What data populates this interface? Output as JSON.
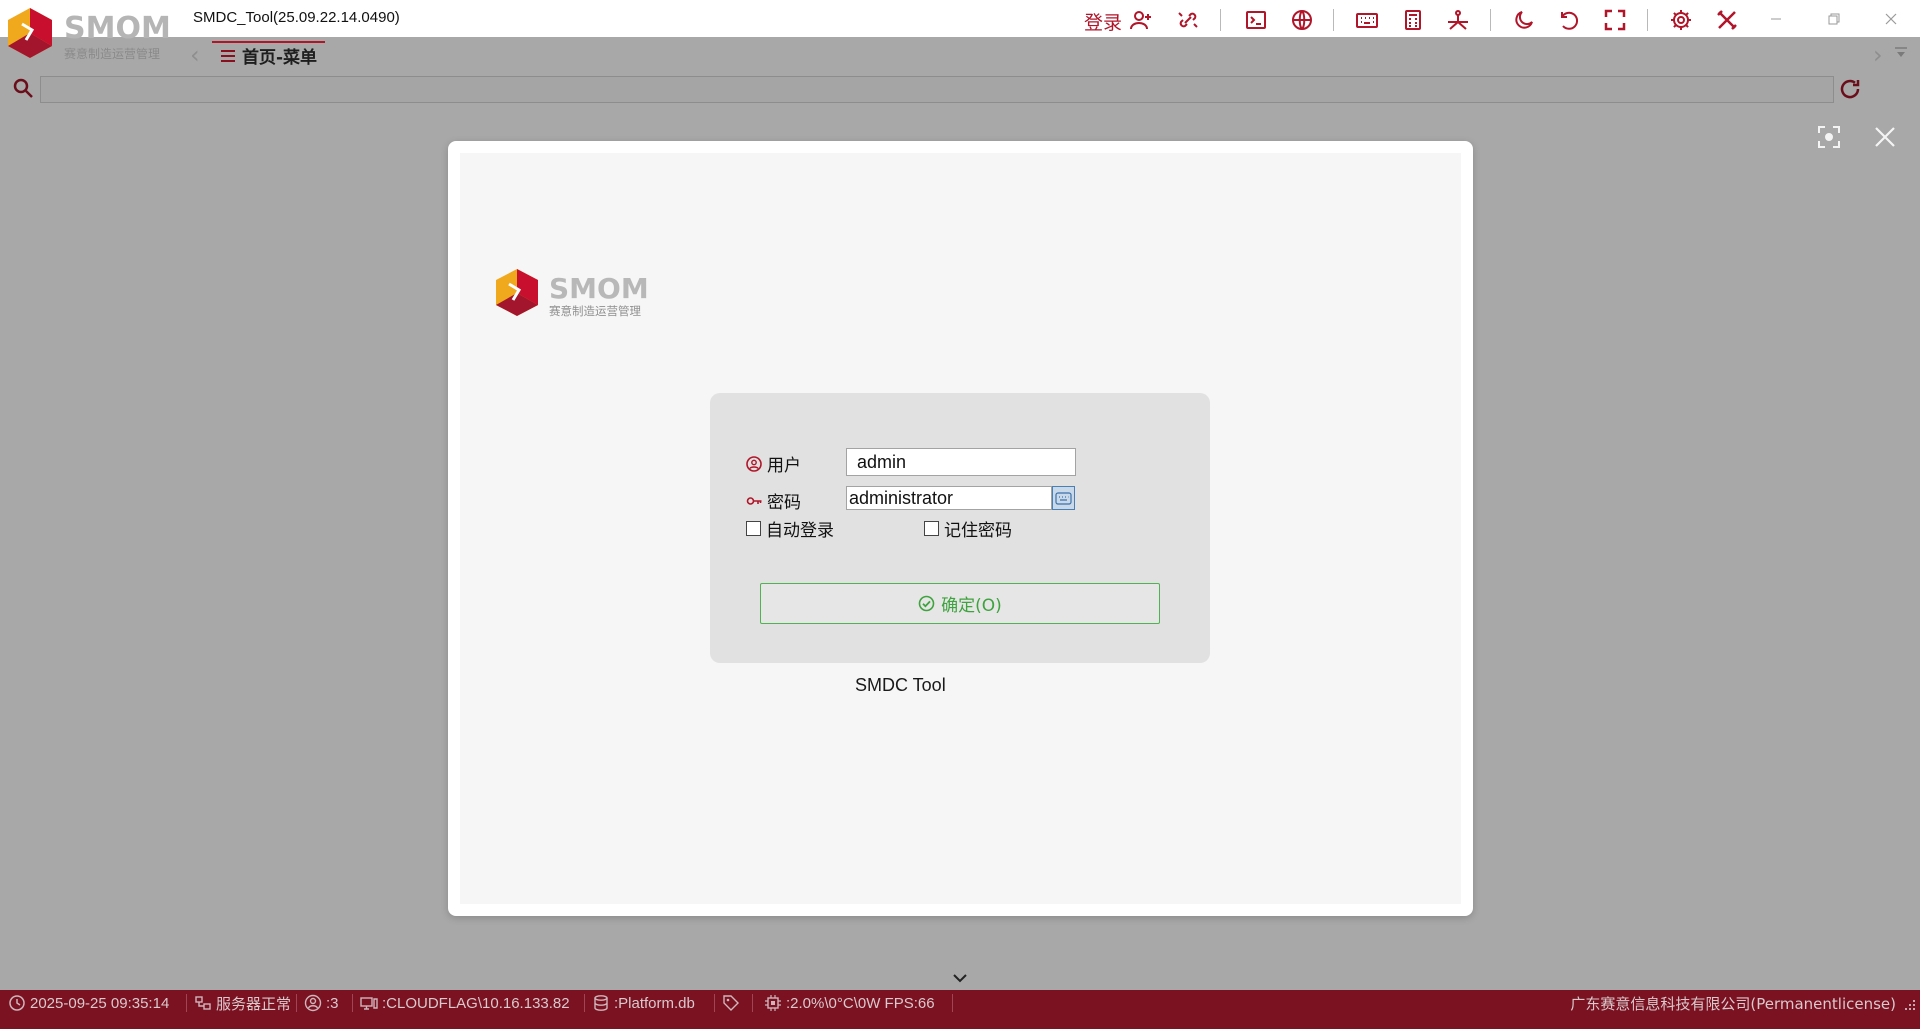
{
  "app": {
    "title": "SMDC_Tool(25.09.22.14.0490)",
    "logo_text": "SMOM",
    "logo_tagline": "赛意制造运营管理"
  },
  "toolbar": {
    "login_label": "登录",
    "icons": [
      "add-user-icon",
      "link-icon",
      "terminal-icon",
      "globe-icon",
      "keyboard-icon",
      "calculator-icon",
      "network-icon",
      "moon-icon",
      "undo-icon",
      "fullscreen-icon",
      "gear-icon",
      "tools-icon"
    ]
  },
  "tabs": {
    "active_label": "首页-菜单"
  },
  "search": {
    "value": "",
    "placeholder": ""
  },
  "login": {
    "user_label": "用户",
    "user_value": "admin",
    "password_label": "密码",
    "password_value": "administrator",
    "auto_login_label": "自动登录",
    "auto_login_checked": false,
    "remember_label": "记住密码",
    "remember_checked": false,
    "confirm_label": "确定(O)",
    "product_name": "SMDC Tool"
  },
  "status": {
    "datetime": "2025-09-25 09:35:14",
    "server": "服务器正常",
    "users": ":3",
    "host": ":CLOUDFLAG\\10.16.133.82",
    "database": ":Platform.db",
    "resources": ":2.0%\\0°C\\0W   FPS:66",
    "company": "广东赛意信息科技有限公司(Permanentlicense)"
  },
  "colors": {
    "brand_red": "#b0152a",
    "status_bar": "#7a1222",
    "confirm_green": "#3ea33e",
    "overlay": "#a8a8a8"
  }
}
